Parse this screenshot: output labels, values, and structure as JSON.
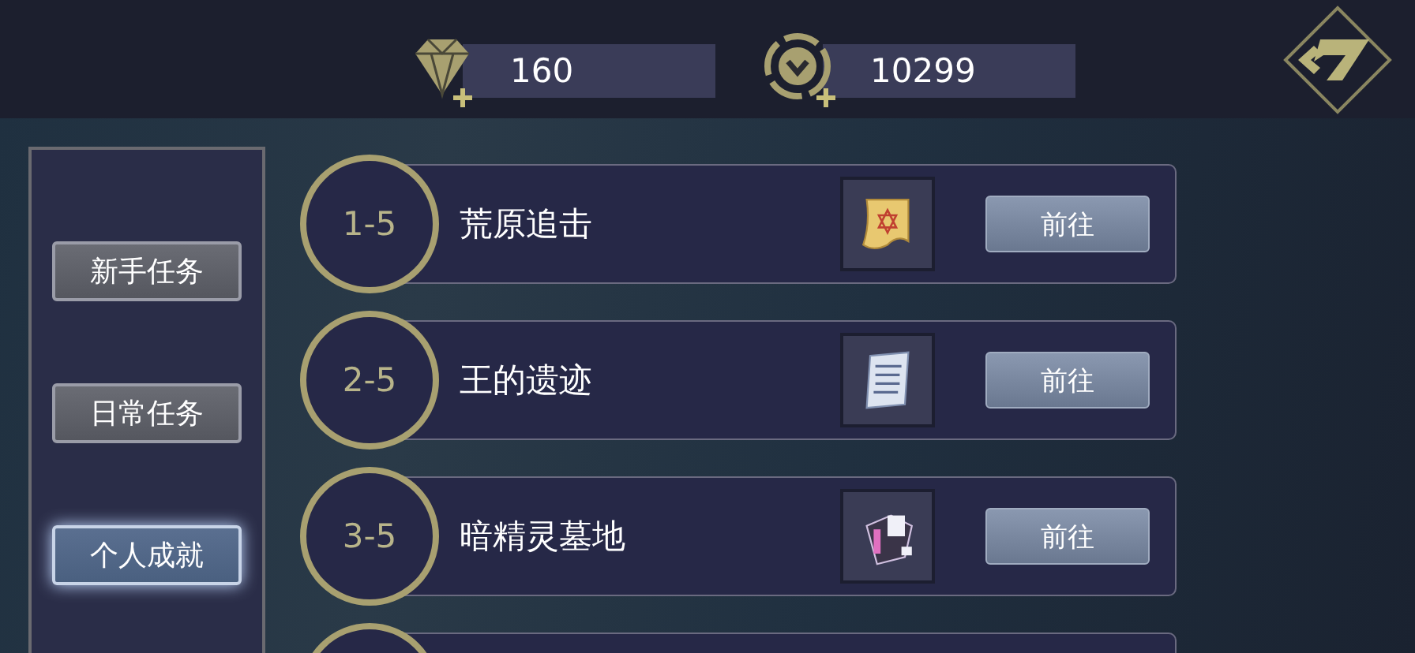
{
  "currencies": [
    {
      "kind": "gem",
      "amount": "160"
    },
    {
      "kind": "coin",
      "amount": "10299"
    }
  ],
  "sidebar": {
    "items": [
      {
        "label": "新手任务",
        "selected": false
      },
      {
        "label": "日常任务",
        "selected": false
      },
      {
        "label": "个人成就",
        "selected": true
      }
    ]
  },
  "tasks": [
    {
      "stage": "1-5",
      "title": "荒原追击",
      "kind": "scroll",
      "button": "前往"
    },
    {
      "stage": "2-5",
      "title": "王的遗迹",
      "kind": "document",
      "button": "前往"
    },
    {
      "stage": "3-5",
      "title": "暗精灵墓地",
      "kind": "device",
      "button": "前往"
    }
  ]
}
